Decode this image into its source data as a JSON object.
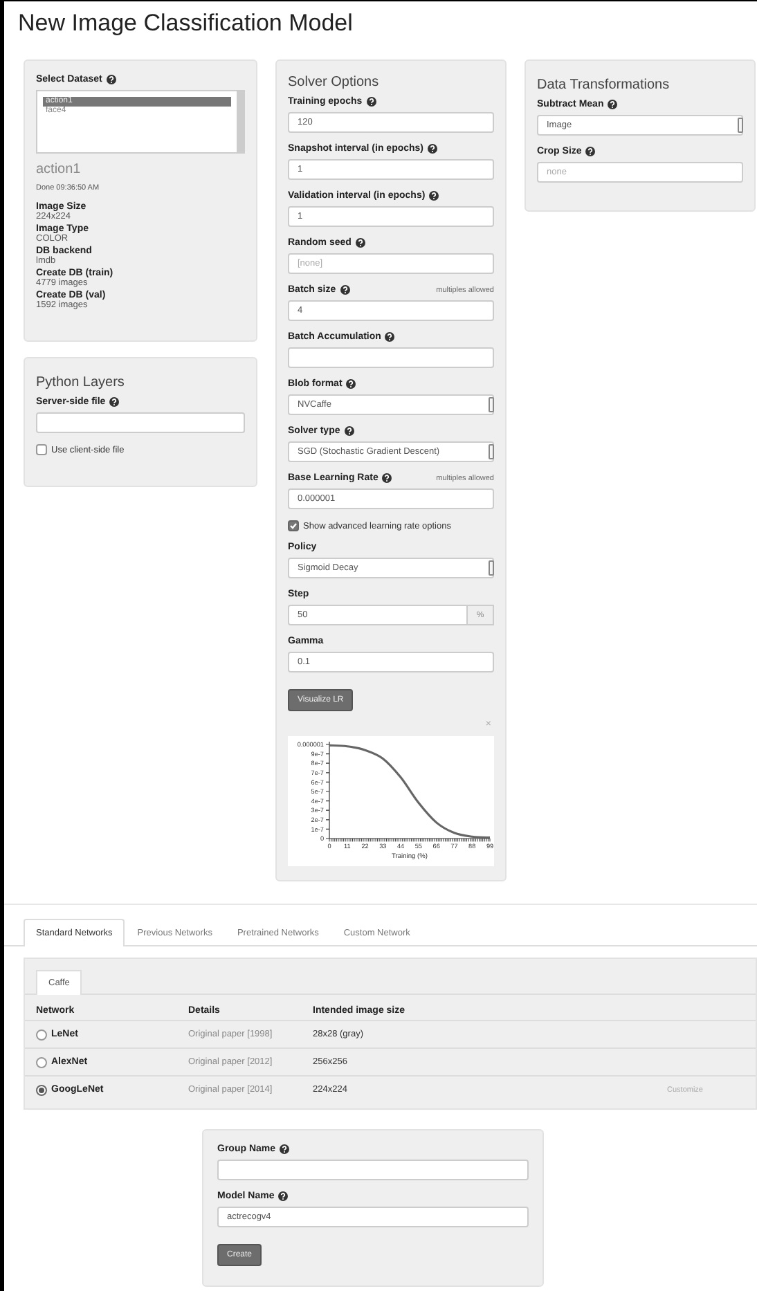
{
  "title": "New Image Classification Model",
  "dataset": {
    "label": "Select Dataset",
    "help": true,
    "options": [
      {
        "label": "action1",
        "selected": true
      },
      {
        "label": "face4",
        "selected": false
      }
    ],
    "name": "action1",
    "status": "Done 09:36:50 AM",
    "info": [
      {
        "term": "Image Size",
        "value": "224x224"
      },
      {
        "term": "Image Type",
        "value": "COLOR"
      },
      {
        "term": "DB backend",
        "value": "lmdb"
      },
      {
        "term": "Create DB (train)",
        "value": "4779 images"
      },
      {
        "term": "Create DB (val)",
        "value": "1592 images"
      }
    ]
  },
  "python_layers": {
    "heading": "Python Layers",
    "fields": [
      {
        "kind": "input",
        "label": "Server-side file",
        "help": true
      },
      {
        "kind": "checkbox",
        "label": "Use client-side file",
        "checked": false
      }
    ]
  },
  "solver": {
    "heading": "Solver Options",
    "fields": [
      {
        "kind": "input",
        "label": "Training epochs",
        "help": true,
        "value": "120"
      },
      {
        "kind": "input",
        "label": "Snapshot interval (in epochs)",
        "help": true,
        "value": "1"
      },
      {
        "kind": "input",
        "label": "Validation interval (in epochs)",
        "help": true,
        "value": "1"
      },
      {
        "kind": "input",
        "label": "Random seed",
        "help": true,
        "placeholder": "[none]"
      },
      {
        "kind": "input",
        "label": "Batch size",
        "help": true,
        "note": "multiples allowed",
        "value": "4"
      },
      {
        "kind": "input",
        "label": "Batch Accumulation",
        "help": true
      },
      {
        "kind": "select",
        "label": "Blob format",
        "help": true,
        "value": "NVCaffe"
      },
      {
        "kind": "select",
        "label": "Solver type",
        "help": true,
        "value": "SGD (Stochastic Gradient Descent)"
      },
      {
        "kind": "input",
        "label": "Base Learning Rate",
        "help": true,
        "note": "multiples allowed",
        "value": "0.000001"
      },
      {
        "kind": "checkbox",
        "label": "Show advanced learning rate options",
        "checked": true
      },
      {
        "kind": "select",
        "label": "Policy",
        "value": "Sigmoid Decay"
      },
      {
        "kind": "addon",
        "label": "Step",
        "value": "50",
        "addon": "%"
      },
      {
        "kind": "input",
        "label": "Gamma",
        "value": "0.1"
      },
      {
        "kind": "button",
        "label": "Visualize LR"
      }
    ],
    "close": "×",
    "chart_data": {
      "type": "line",
      "xlabel": "Training (%)",
      "x": [
        0,
        11,
        22,
        33,
        44,
        55,
        66,
        77,
        88,
        99
      ],
      "series": [
        {
          "color": "#666666",
          "values": [
            9.9e-07,
            9.8e-07,
            9.4e-07,
            8.5e-07,
            6.5e-07,
            3.8e-07,
            1.7e-07,
            6e-08,
            2e-08,
            1e-08
          ]
        }
      ],
      "xlim": [
        0,
        99
      ],
      "ylim": [
        0,
        1e-06
      ],
      "xticks": [
        0,
        11,
        22,
        33,
        44,
        55,
        66,
        77,
        88,
        99
      ],
      "yticks": [
        {
          "value": 0,
          "label": "0"
        },
        {
          "value": 1e-07,
          "label": "1e-7"
        },
        {
          "value": 2e-07,
          "label": "2e-7"
        },
        {
          "value": 3e-07,
          "label": "3e-7"
        },
        {
          "value": 4e-07,
          "label": "4e-7"
        },
        {
          "value": 5e-07,
          "label": "5e-7"
        },
        {
          "value": 6e-07,
          "label": "6e-7"
        },
        {
          "value": 7e-07,
          "label": "7e-7"
        },
        {
          "value": 8e-07,
          "label": "8e-7"
        },
        {
          "value": 9e-07,
          "label": "9e-7"
        },
        {
          "value": 1e-06,
          "label": "0.000001"
        }
      ]
    }
  },
  "transforms": {
    "heading": "Data Transformations",
    "fields": [
      {
        "kind": "select",
        "label": "Subtract Mean",
        "help": true,
        "value": "Image"
      },
      {
        "kind": "input",
        "label": "Crop Size",
        "help": true,
        "placeholder": "none"
      }
    ]
  },
  "networks": {
    "tabs": [
      {
        "label": "Standard Networks",
        "selected": true
      },
      {
        "label": "Previous Networks",
        "selected": false
      },
      {
        "label": "Pretrained Networks",
        "selected": false
      },
      {
        "label": "Custom Network",
        "selected": false
      }
    ],
    "framework_tabs": [
      {
        "label": "Caffe",
        "selected": true
      }
    ],
    "columns": [
      "Network",
      "Details",
      "Intended image size"
    ],
    "rows": [
      {
        "network": "LeNet",
        "details": "Original paper [1998]",
        "size": "28x28 (gray)",
        "selected": false
      },
      {
        "network": "AlexNet",
        "details": "Original paper [2012]",
        "size": "256x256",
        "selected": false
      },
      {
        "network": "GoogLeNet",
        "details": "Original paper [2014]",
        "size": "224x224",
        "selected": true,
        "action": "Customize"
      }
    ]
  },
  "model": {
    "fields": [
      {
        "kind": "input",
        "label": "Group Name",
        "help": true
      },
      {
        "kind": "input",
        "label": "Model Name",
        "help": true,
        "value": "actrecogv4"
      },
      {
        "kind": "button",
        "label": "Create"
      }
    ]
  }
}
